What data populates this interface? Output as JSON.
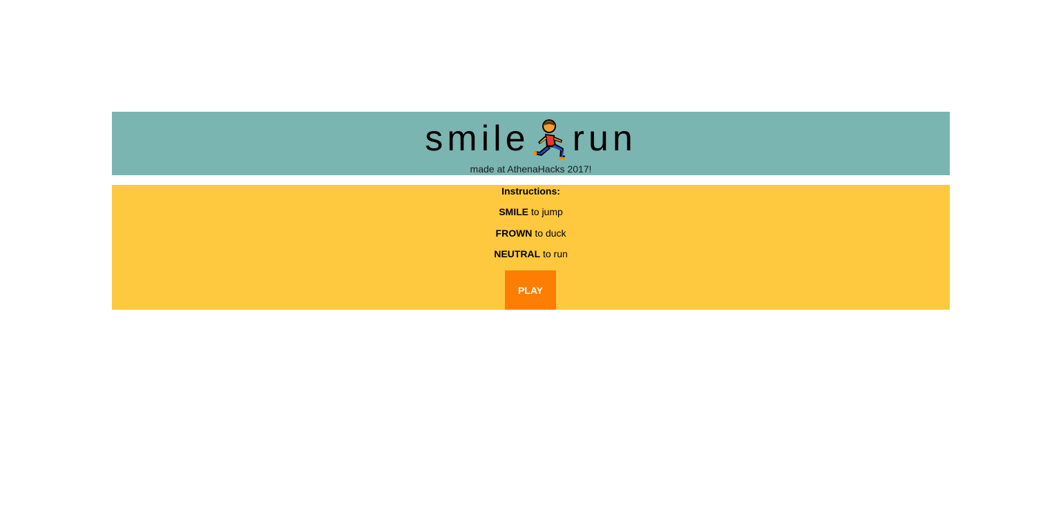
{
  "header": {
    "title_left": "smile",
    "title_icon": "runner-icon",
    "title_right": "run",
    "tagline": "made at AthenaHacks 2017!",
    "background_color": "#7bb5b1"
  },
  "instructions": {
    "heading": "Instructions:",
    "items": [
      {
        "action": "SMILE",
        "result": "to jump"
      },
      {
        "action": "FROWN",
        "result": "to duck"
      },
      {
        "action": "NEUTRAL",
        "result": "to run"
      }
    ],
    "background_color": "#fec93f"
  },
  "play_button": {
    "label": "PLAY",
    "color": "#fd7e02"
  }
}
